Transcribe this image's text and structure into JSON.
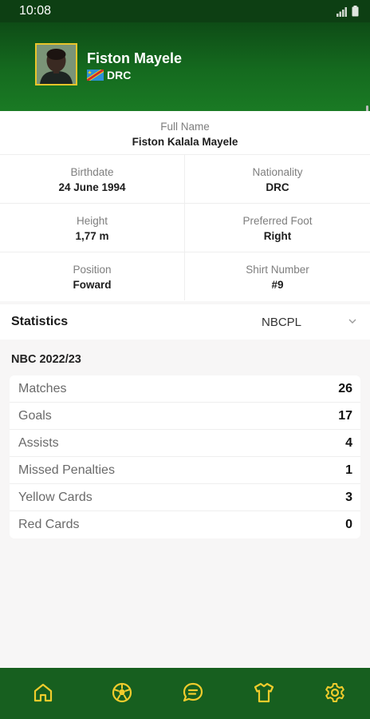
{
  "status_bar": {
    "time": "10:08"
  },
  "player": {
    "name": "Fiston Mayele",
    "country": "DRC"
  },
  "details": {
    "full_name": {
      "label": "Full Name",
      "value": "Fiston Kalala Mayele"
    },
    "birthdate": {
      "label": "Birthdate",
      "value": "24 June 1994"
    },
    "nationality": {
      "label": "Nationality",
      "value": "DRC"
    },
    "height": {
      "label": "Height",
      "value": "1,77 m"
    },
    "preferred_foot": {
      "label": "Preferred Foot",
      "value": "Right"
    },
    "position": {
      "label": "Position",
      "value": "Foward"
    },
    "shirt_number": {
      "label": "Shirt Number",
      "value": "#9"
    }
  },
  "statistics": {
    "title": "Statistics",
    "selected_competition": "NBCPL",
    "season": "NBC 2022/23",
    "rows": [
      {
        "label": "Matches",
        "value": "26"
      },
      {
        "label": "Goals",
        "value": "17"
      },
      {
        "label": "Assists",
        "value": "4"
      },
      {
        "label": "Missed Penalties",
        "value": "1"
      },
      {
        "label": "Yellow Cards",
        "value": "3"
      },
      {
        "label": "Red Cards",
        "value": "0"
      }
    ]
  },
  "bottom_nav": {
    "items": [
      {
        "icon": "home-icon"
      },
      {
        "icon": "football-icon"
      },
      {
        "icon": "chat-icon"
      },
      {
        "icon": "jersey-icon"
      },
      {
        "icon": "settings-icon"
      }
    ]
  },
  "colors": {
    "header_green": "#156b1f",
    "nav_green": "#175f1f",
    "accent_yellow": "#e9c52a"
  }
}
